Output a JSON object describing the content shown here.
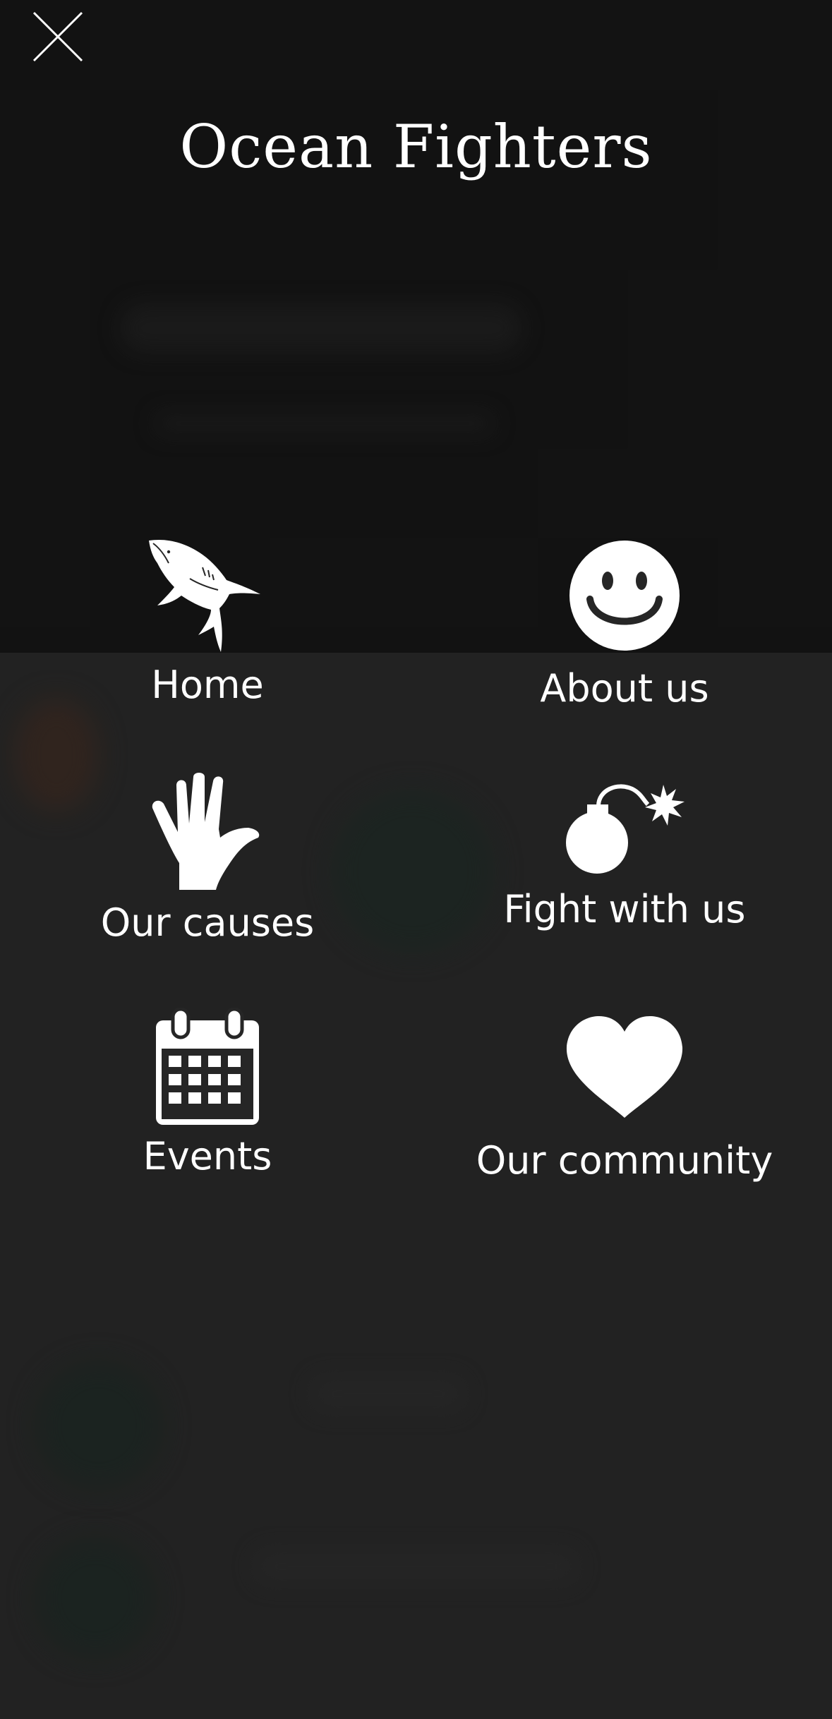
{
  "site": {
    "title": "Ocean Fighters"
  },
  "menu": {
    "items": [
      {
        "label": "Home",
        "icon": "shark-icon"
      },
      {
        "label": "About us",
        "icon": "smiley-icon"
      },
      {
        "label": "Our causes",
        "icon": "hand-icon"
      },
      {
        "label": "Fight with us",
        "icon": "bomb-icon"
      },
      {
        "label": "Events",
        "icon": "calendar-icon"
      },
      {
        "label": "Our community",
        "icon": "heart-icon"
      }
    ]
  },
  "colors": {
    "overlay_dark": "#121212",
    "overlay_light": "#272727",
    "foreground": "#ffffff"
  }
}
